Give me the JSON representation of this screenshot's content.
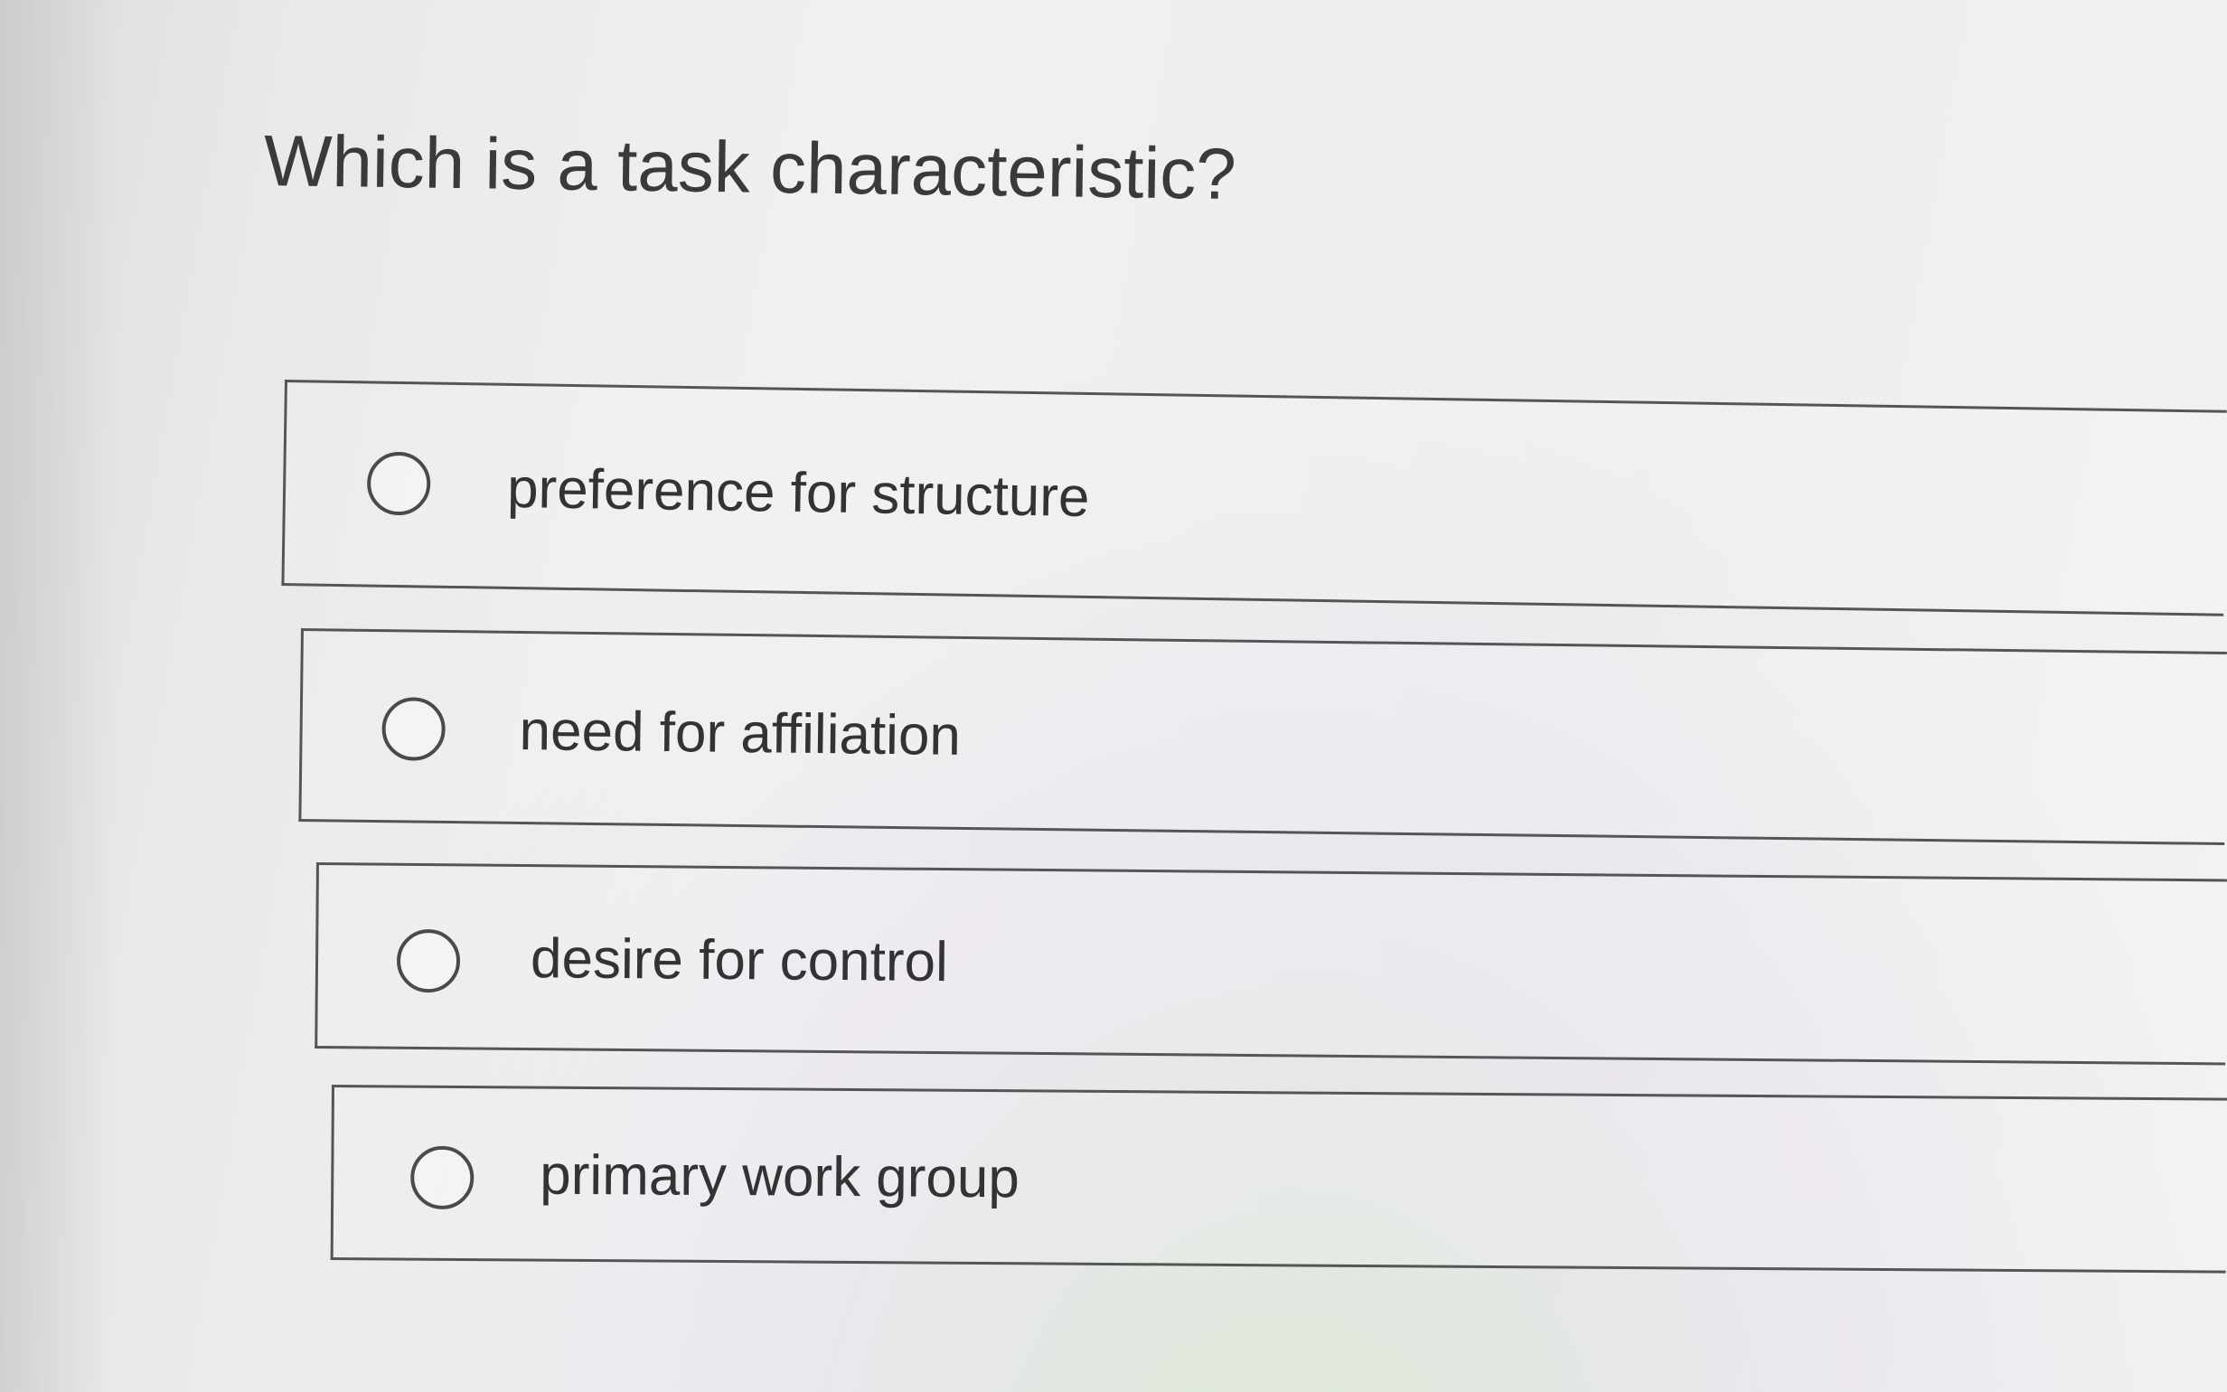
{
  "question": {
    "text": "Which is a task characteristic?"
  },
  "options": [
    {
      "label": "preference for structure",
      "selected": false
    },
    {
      "label": "need for affiliation",
      "selected": false
    },
    {
      "label": "desire for control",
      "selected": false
    },
    {
      "label": "primary work group",
      "selected": false
    }
  ],
  "colors": {
    "text": "#333333",
    "border": "#555555",
    "background": "#eeeeee"
  }
}
